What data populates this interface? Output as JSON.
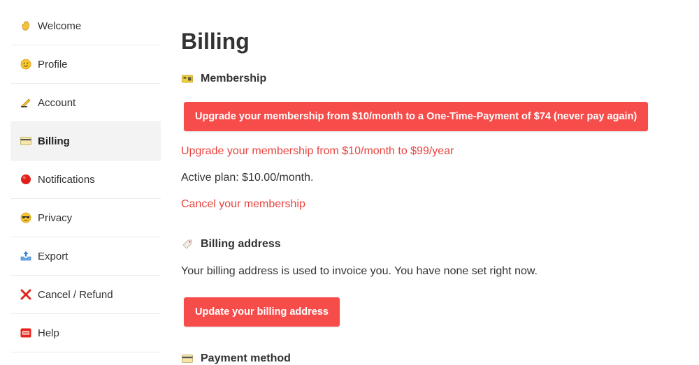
{
  "sidebar": {
    "items": [
      {
        "label": "Welcome",
        "icon": "waving-hand-icon"
      },
      {
        "label": "Profile",
        "icon": "smiley-face-icon"
      },
      {
        "label": "Account",
        "icon": "writing-hand-icon"
      },
      {
        "label": "Billing",
        "icon": "credit-card-icon",
        "active": true
      },
      {
        "label": "Notifications",
        "icon": "red-circle-icon"
      },
      {
        "label": "Privacy",
        "icon": "sunglasses-face-icon"
      },
      {
        "label": "Export",
        "icon": "outbox-tray-icon"
      },
      {
        "label": "Cancel / Refund",
        "icon": "cross-mark-icon"
      },
      {
        "label": "Help",
        "icon": "sos-icon"
      }
    ]
  },
  "main": {
    "title": "Billing",
    "membership": {
      "heading": "Membership",
      "upgrade_lifetime_button": "Upgrade your membership from $10/month to a One-Time-Payment of $74 (never pay again)",
      "upgrade_yearly_link": "Upgrade your membership from $10/month to $99/year",
      "active_plan": "Active plan: $10.00/month.",
      "cancel_link": "Cancel your membership"
    },
    "billing_address": {
      "heading": "Billing address",
      "description": "Your billing address is used to invoice you. You have none set right now.",
      "update_button": "Update your billing address"
    },
    "payment_method": {
      "heading": "Payment method"
    }
  },
  "colors": {
    "accent": "#f64c4a",
    "link": "#e8433e",
    "active_background": "#f3f3f3"
  }
}
